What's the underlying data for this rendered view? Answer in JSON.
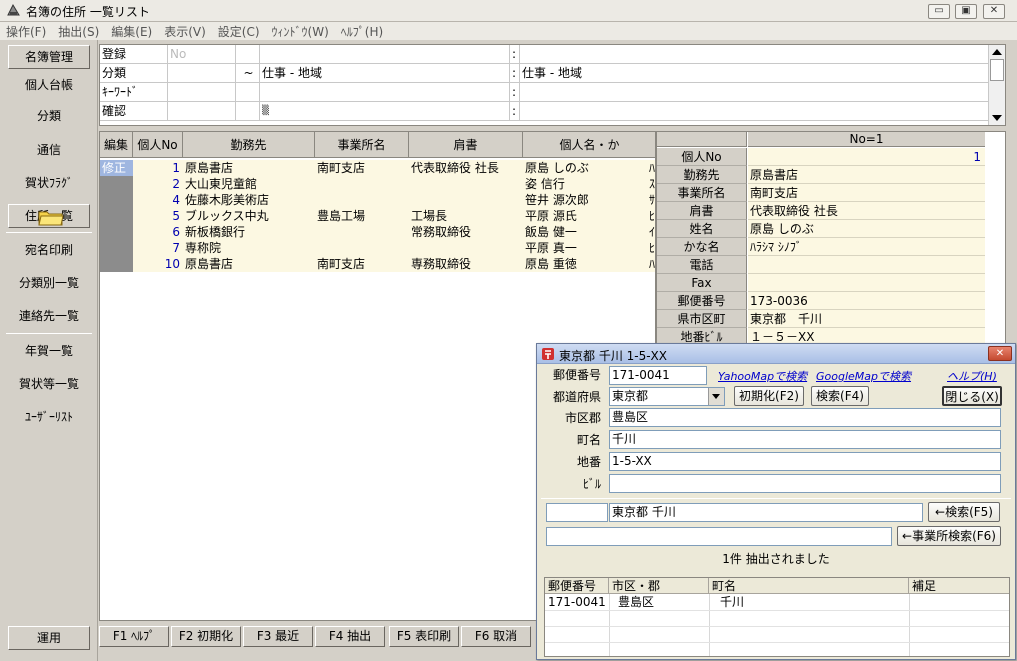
{
  "window": {
    "title": "名簿の住所 一覧リスト",
    "min": "▭",
    "max": "▣",
    "close": "✕"
  },
  "menu": [
    "操作(F)",
    "抽出(S)",
    "編集(E)",
    "表示(V)",
    "設定(C)",
    "ｳｨﾝﾄﾞｳ(W)",
    "ﾍﾙﾌﾟ(H)"
  ],
  "nav": [
    "名簿管理",
    "個人台帳",
    "分類",
    "通信",
    "賀状ﾌﾗｸﾞ",
    "住所一覧",
    "宛名印刷",
    "分類別一覧",
    "連絡先一覧",
    "年賀一覧",
    "賀状等一覧",
    "ﾕｰｻﾞｰﾘｽﾄ",
    "運用"
  ],
  "filter": {
    "labels": [
      "登録",
      "分類",
      "ｷｰﾜｰﾄﾞ",
      "確認"
    ],
    "no_placeholder": "No",
    "tilde": "~",
    "class_left": "仕事 - 地域",
    "class_right": "仕事 - 地域",
    "colon": ":",
    "check_mark": "▒"
  },
  "grid": {
    "headers": [
      "編集",
      "個人No",
      "勤務先",
      "事業所名",
      "肩書",
      "個人名・か"
    ],
    "rows": [
      {
        "edit": "修正",
        "no": "1",
        "company": "原島書店",
        "office": "南町支店",
        "title": "代表取締役 社長",
        "name": "原島 しのぶ",
        "extra": "ﾊ"
      },
      {
        "edit": "",
        "no": "2",
        "company": "大山東児童館",
        "office": "",
        "title": "",
        "name": "姿 信行",
        "extra": "ｽ"
      },
      {
        "edit": "",
        "no": "4",
        "company": "佐藤木彫美術店",
        "office": "",
        "title": "",
        "name": "笹井 源次郎",
        "extra": "ｻ"
      },
      {
        "edit": "",
        "no": "5",
        "company": "ブルックス中丸",
        "office": "豊島工場",
        "title": "工場長",
        "name": "平原 源氏",
        "extra": "ﾋ"
      },
      {
        "edit": "",
        "no": "6",
        "company": "新板橋銀行",
        "office": "",
        "title": "常務取締役",
        "name": "飯島 健一",
        "extra": "ｲ"
      },
      {
        "edit": "",
        "no": "7",
        "company": "専称院",
        "office": "",
        "title": "",
        "name": "平原 真一",
        "extra": "ﾋ"
      },
      {
        "edit": "",
        "no": "10",
        "company": "原島書店",
        "office": "南町支店",
        "title": "専務取締役",
        "name": "原島 重徳",
        "extra": "ﾊ"
      }
    ]
  },
  "detail": {
    "header": "No=1",
    "rows": [
      {
        "label": "個人No",
        "value": "1"
      },
      {
        "label": "勤務先",
        "value": "原島書店"
      },
      {
        "label": "事業所名",
        "value": "南町支店"
      },
      {
        "label": "肩書",
        "value": "代表取締役 社長"
      },
      {
        "label": "姓名",
        "value": "原島 しのぶ"
      },
      {
        "label": "かな名",
        "value": "ﾊﾗｼﾏ ｼﾉﾌﾞ"
      },
      {
        "label": "電話",
        "value": ""
      },
      {
        "label": "Fax",
        "value": ""
      },
      {
        "label": "郵便番号",
        "value": "173-0036"
      },
      {
        "label": "県市区町",
        "value": "東京都　千川"
      },
      {
        "label": "地番ﾋﾞﾙ",
        "value": "１－５－XX"
      }
    ]
  },
  "fkeys": [
    "F1 ﾍﾙﾌﾟ",
    "F2 初期化",
    "F3 最近",
    "F4 抽出",
    "F5 表印刷",
    "F6 取消"
  ],
  "dialog": {
    "title": "東京都 千川 1-5-XX",
    "close": "✕",
    "labels": {
      "zip": "郵便番号",
      "pref": "都道府県",
      "city": "市区郡",
      "town": "町名",
      "banchi": "地番",
      "bldg": "ﾋﾞﾙ"
    },
    "zip": "171-0041",
    "pref": "東京都",
    "city": "豊島区",
    "town": "千川",
    "banchi": "1-5-XX",
    "bldg": "",
    "links": {
      "yahoo": "YahooMapで検索",
      "google": "GoogleMapで検索",
      "help": "ヘルプ(H)"
    },
    "buttons": {
      "init": "初期化(F2)",
      "search": "検索(F4)",
      "close": "閉じる(X)",
      "search_back": "←検索(F5)",
      "office_search": "←事業所検索(F6)"
    },
    "search_field": "東京都 千川",
    "status": "1件 抽出されました",
    "result_headers": [
      "郵便番号",
      "市区・郡",
      "町名",
      "補足"
    ],
    "results": [
      {
        "zip": "171-0041",
        "city": "豊島区",
        "town": "千川",
        "note": ""
      }
    ]
  }
}
